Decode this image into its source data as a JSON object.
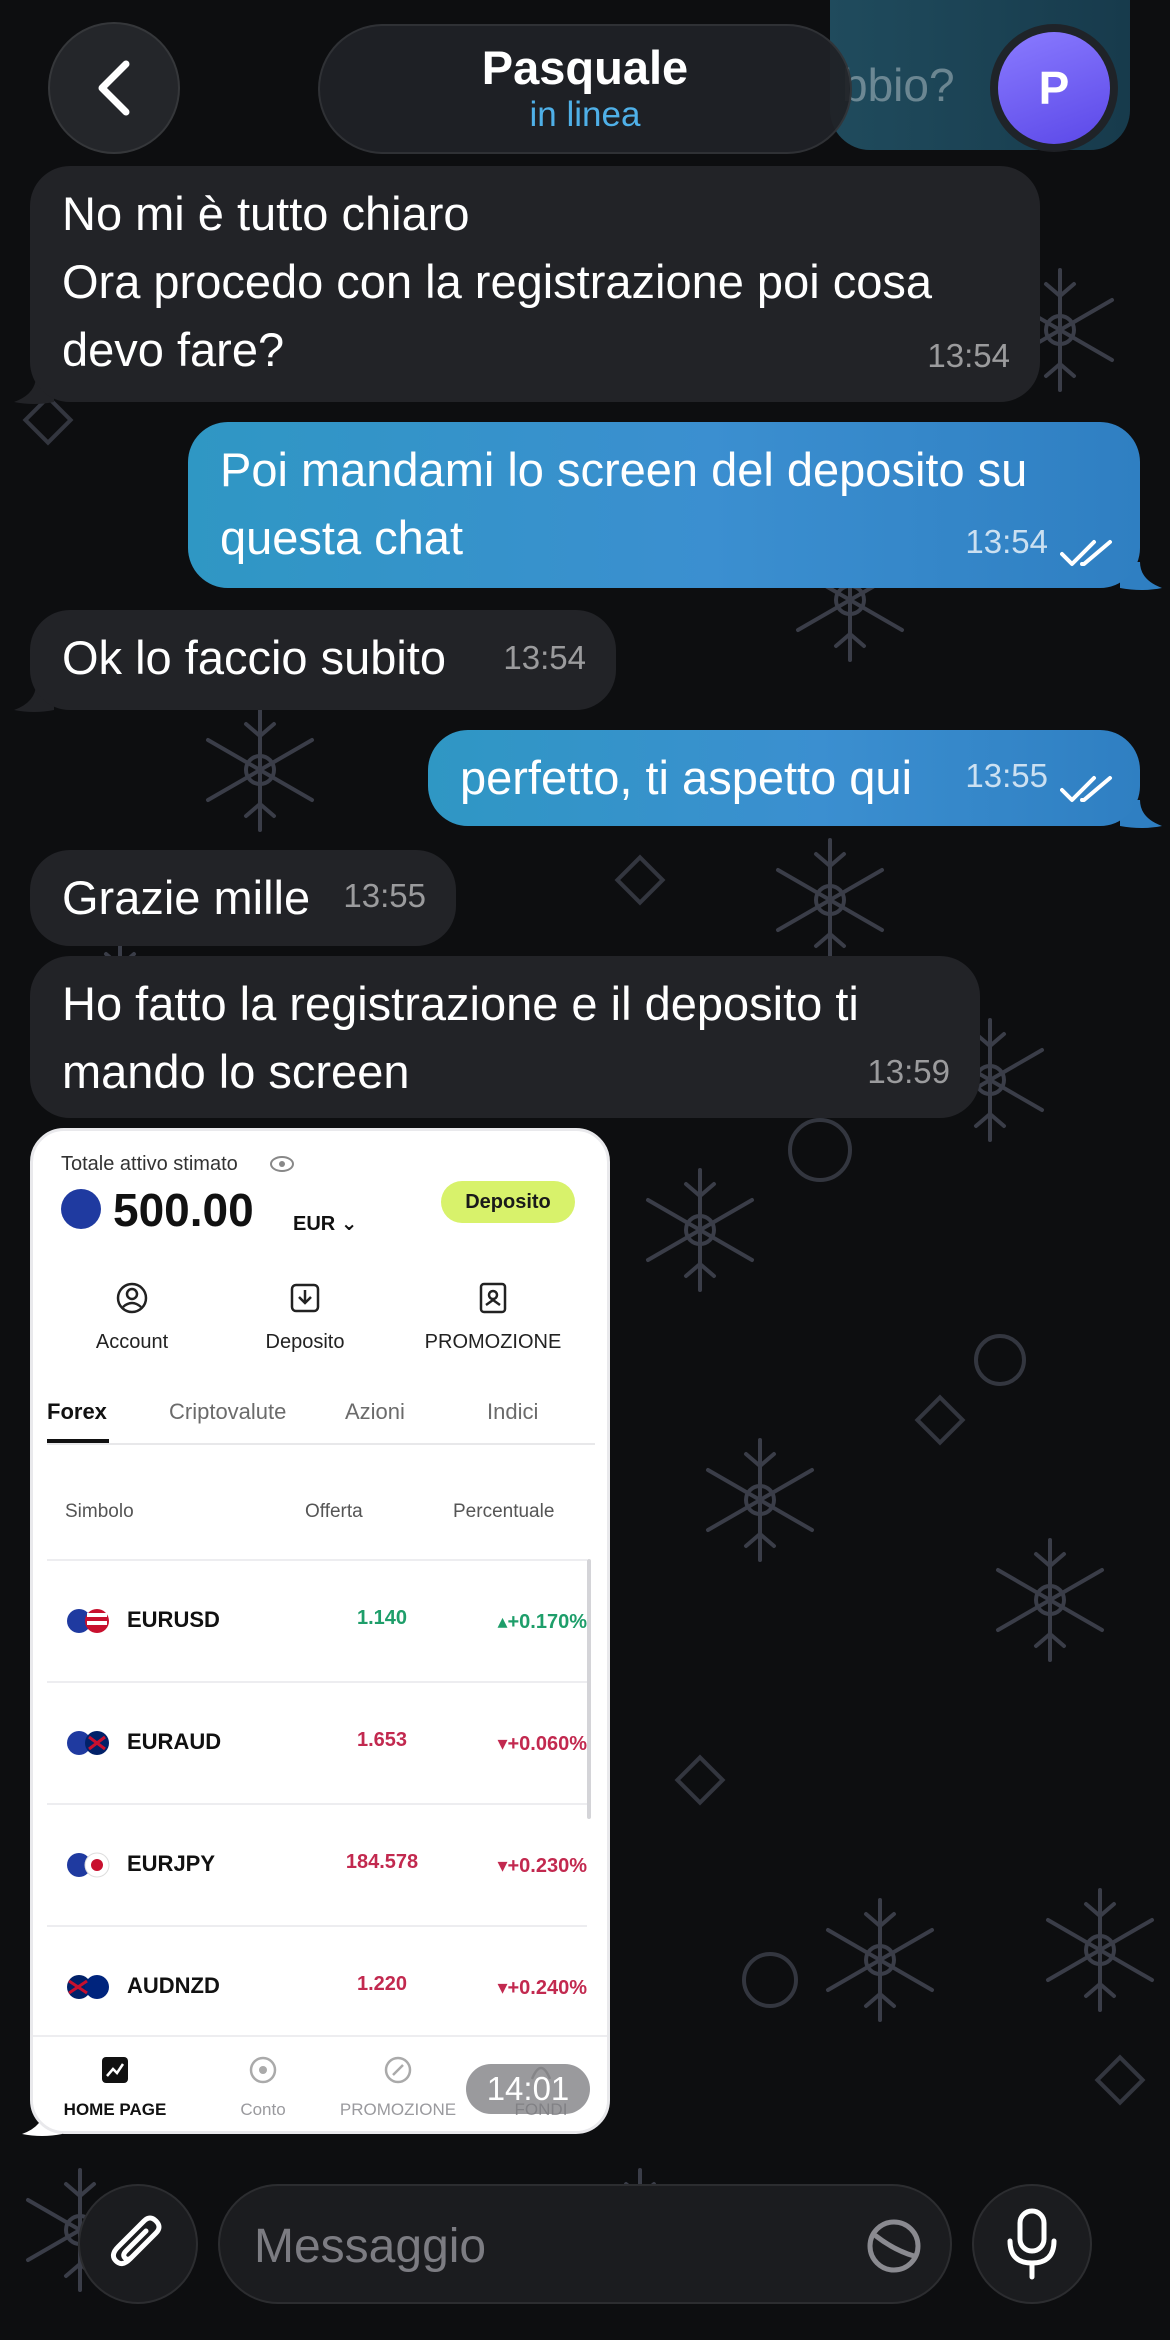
{
  "header": {
    "contact_name": "Pasquale",
    "status": "in linea",
    "avatar_initial": "P",
    "behind_text": "bbio?"
  },
  "messages": [
    {
      "direction": "in",
      "text": "No mi è tutto chiaro\nOra procedo con la registrazione poi cosa devo fare?",
      "time": "13:54"
    },
    {
      "direction": "out",
      "text": "Poi mandami lo screen del deposito su questa chat",
      "time": "13:54",
      "read": true
    },
    {
      "direction": "in",
      "text": "Ok lo faccio subito",
      "time": "13:54"
    },
    {
      "direction": "out",
      "text": "perfetto, ti aspetto qui",
      "time": "13:55",
      "read": true
    },
    {
      "direction": "in",
      "text": "Grazie mille",
      "time": "13:55"
    },
    {
      "direction": "in",
      "text": "Ho fatto la registrazione e il deposito ti mando lo screen",
      "time": "13:59"
    }
  ],
  "image_message": {
    "time": "14:01",
    "screen": {
      "balance_label": "Totale attivo stimato",
      "balance": "500.00",
      "currency": "EUR",
      "deposit_button": "Deposito",
      "actions": [
        "Account",
        "Deposito",
        "PROMOZIONE"
      ],
      "tabs": [
        "Forex",
        "Criptovalute",
        "Azioni",
        "Indici"
      ],
      "active_tab": "Forex",
      "columns": [
        "Simbolo",
        "Offerta",
        "Percentuale"
      ],
      "rows": [
        {
          "symbol": "EURUSD",
          "price": "1.140",
          "change": "+0.170%",
          "trend": "up"
        },
        {
          "symbol": "EURAUD",
          "price": "1.653",
          "change": "+0.060%",
          "trend": "down"
        },
        {
          "symbol": "EURJPY",
          "price": "184.578",
          "change": "+0.230%",
          "trend": "down"
        },
        {
          "symbol": "AUDNZD",
          "price": "1.220",
          "change": "+0.240%",
          "trend": "down"
        }
      ],
      "nav": [
        "HOME PAGE",
        "Conto",
        "PROMOZIONE",
        "FONDI"
      ]
    }
  },
  "composer": {
    "placeholder": "Messaggio"
  },
  "colors": {
    "background": "#0d0e10",
    "incoming_bubble": "#222327",
    "outgoing_bubble": "#3b8fd0",
    "status_text": "#4fb0e8",
    "avatar": "#6e5cf0"
  }
}
